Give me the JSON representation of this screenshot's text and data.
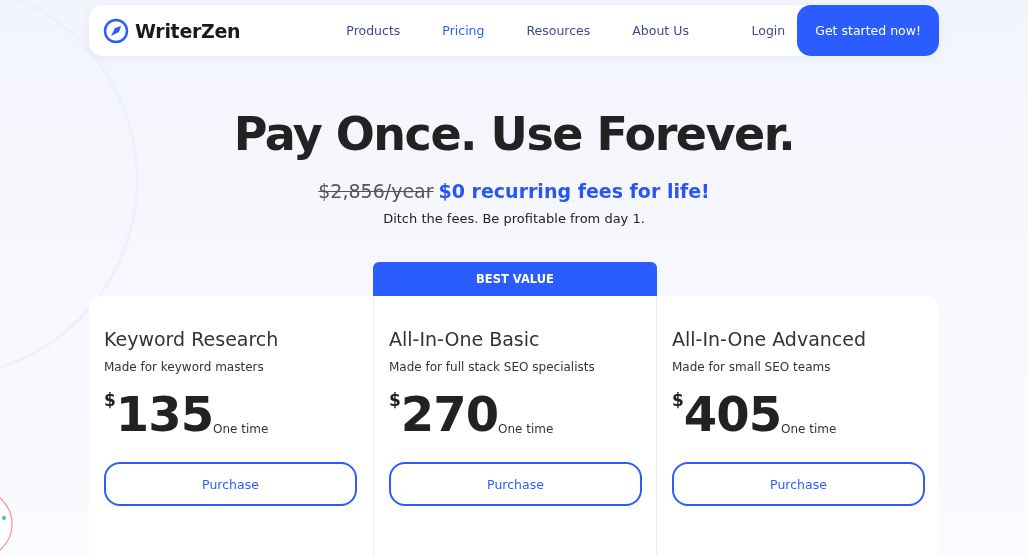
{
  "brand": {
    "name": "WriterZen"
  },
  "nav": [
    {
      "label": "Products",
      "selected": false
    },
    {
      "label": "Pricing",
      "selected": true
    },
    {
      "label": "Resources",
      "selected": false
    },
    {
      "label": "About Us",
      "selected": false
    }
  ],
  "login": "Login",
  "cta": "Get started now!",
  "hero": {
    "title": "Pay Once. Use Forever.",
    "old_price": "$2,856/year",
    "offer": "$0 recurring fees for life!",
    "subtitle": "Ditch the fees. Be profitable from day 1."
  },
  "plans": [
    {
      "name": "Keyword Research",
      "tagline": "Made for keyword masters",
      "currency": "$",
      "price": "135",
      "period": "One time",
      "button": "Purchase"
    },
    {
      "name": "All-In-One Basic",
      "tagline": "Made for full stack SEO specialists",
      "currency": "$",
      "price": "270",
      "period": "One time",
      "button": "Purchase",
      "badge": "BEST VALUE"
    },
    {
      "name": "All-In-One Advanced",
      "tagline": "Made for small SEO teams",
      "currency": "$",
      "price": "405",
      "period": "One time",
      "button": "Purchase"
    }
  ]
}
